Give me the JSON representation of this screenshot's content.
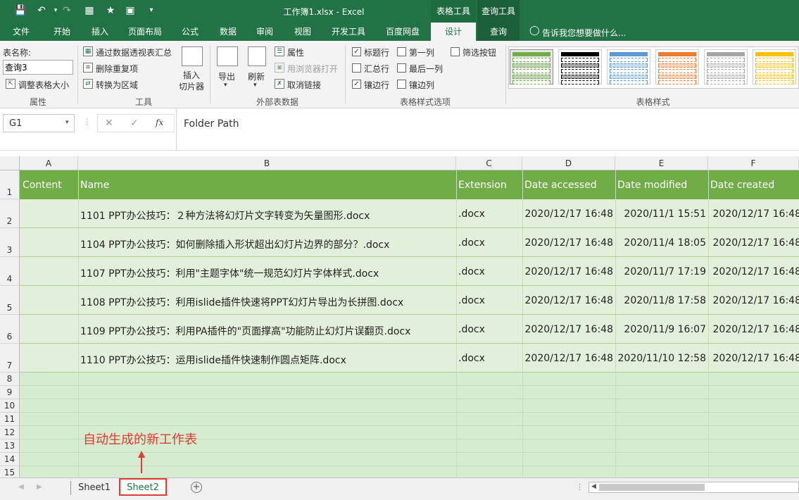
{
  "window": {
    "title": "工作簿1.xlsx - Excel"
  },
  "context_tabs": [
    "表格工具",
    "查询工具"
  ],
  "tabs": [
    "文件",
    "开始",
    "插入",
    "页面布局",
    "公式",
    "数据",
    "审阅",
    "视图",
    "开发工具",
    "百度网盘",
    "设计",
    "查询"
  ],
  "active_tab": "设计",
  "tell_me": "告诉我您想要做什么...",
  "ribbon": {
    "props": {
      "name_label": "表名称:",
      "name_value": "查询3",
      "resize": "调整表格大小",
      "group": "属性"
    },
    "tools": {
      "pivot": "通过数据透视表汇总",
      "dedupe": "删除重复项",
      "convert": "转换为区域",
      "slicer1": "插入",
      "slicer2": "切片器",
      "group": "工具"
    },
    "external": {
      "export": "导出",
      "refresh": "刷新",
      "properties": "属性",
      "browser": "用浏览器打开",
      "unlink": "取消链接",
      "group": "外部表数据"
    },
    "style_options": {
      "header_row": "标题行",
      "total_row": "汇总行",
      "banded_rows": "镶边行",
      "first_col": "第一列",
      "last_col": "最后一列",
      "banded_cols": "镶边列",
      "filter_btn": "筛选按钮",
      "group": "表格样式选项"
    },
    "styles": {
      "group": "表格样式",
      "swatches": [
        "#70ad47",
        "#000000",
        "#5b9bd5",
        "#ed7d31",
        "#a5a5a5",
        "#ffc000"
      ]
    }
  },
  "formula": {
    "namebox": "G1",
    "content": "Folder Path",
    "fx": "fx"
  },
  "columns": [
    "A",
    "B",
    "C",
    "D",
    "E",
    "F"
  ],
  "headers": [
    "Content",
    "Name",
    "Extension",
    "Date accessed",
    "Date modified",
    "Date created"
  ],
  "rows": [
    {
      "num": "2",
      "name": "1101   PPT办公技巧：２种方法将幻灯片文字转变为矢量图形.docx",
      "ext": ".docx",
      "accessed": "2020/12/17 16:48",
      "modified": "2020/11/1 15:51",
      "created": "2020/12/17 16:48"
    },
    {
      "num": "3",
      "name": "1104   PPT办公技巧：如何删除插入形状超出幻灯片边界的部分？.docx",
      "ext": ".docx",
      "accessed": "2020/12/17 16:48",
      "modified": "2020/11/4 18:05",
      "created": "2020/12/17 16:48"
    },
    {
      "num": "4",
      "name": "1107   PPT办公技巧：利用\"主题字体\"统一规范幻灯片字体样式.docx",
      "ext": ".docx",
      "accessed": "2020/12/17 16:48",
      "modified": "2020/11/7 17:19",
      "created": "2020/12/17 16:48"
    },
    {
      "num": "5",
      "name": "1108   PPT办公技巧：利用islide插件快速将PPT幻灯片导出为长拼图.docx",
      "ext": ".docx",
      "accessed": "2020/12/17 16:48",
      "modified": "2020/11/8 17:58",
      "created": "2020/12/17 16:48"
    },
    {
      "num": "6",
      "name": "1109   PPT办公技巧：利用PA插件的\"页面撑高\"功能防止幻灯片误翻页.docx",
      "ext": ".docx",
      "accessed": "2020/12/17 16:48",
      "modified": "2020/11/9 16:07",
      "created": "2020/12/17 16:48"
    },
    {
      "num": "7",
      "name": "1110   PPT办公技巧：运用islide插件快速制作圆点矩阵.docx",
      "ext": ".docx",
      "accessed": "2020/12/17 16:48",
      "modified": "2020/11/10 12:58",
      "created": "2020/12/17 16:48"
    }
  ],
  "empty_rows": [
    "8",
    "9",
    "10",
    "11",
    "12",
    "13",
    "14",
    "15"
  ],
  "header_row_num": "1",
  "annotation": "自动生成的新工作表",
  "sheets": [
    "Sheet1",
    "Sheet2"
  ],
  "active_sheet": "Sheet2"
}
